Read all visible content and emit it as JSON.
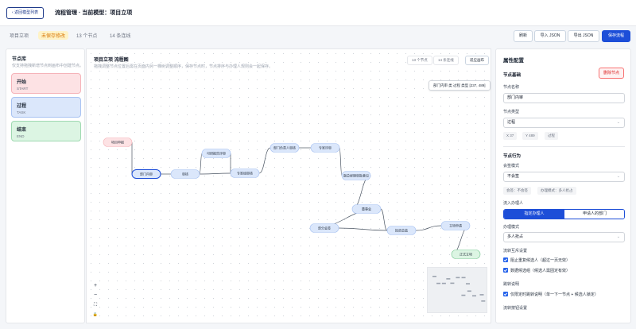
{
  "topbar": {
    "back_label": "返回模型列表",
    "title": "流程管理 · 当前模型：项目立项"
  },
  "status": {
    "model_name": "项目立项",
    "unsaved": "未保存修改",
    "node_count": "13 个节点",
    "edge_count": "14 条连线"
  },
  "toolbar": {
    "refresh": "刷新",
    "import_json": "导入 JSON",
    "export_json": "导出 JSON",
    "save_model": "保存流程"
  },
  "palette": {
    "title": "节点库",
    "subtitle": "仅支持拖拽新增节点到画布中创建节点。",
    "items": [
      {
        "name": "开始",
        "code": "START",
        "bg": "#fde2e4",
        "border": "#f5b3b9"
      },
      {
        "name": "过程",
        "code": "TASK",
        "bg": "#dbe7fb",
        "border": "#a9c3f2"
      },
      {
        "name": "结束",
        "code": "END",
        "bg": "#dcf5e3",
        "border": "#9fd9b1"
      }
    ]
  },
  "canvas": {
    "title": "项目立项 流程图",
    "subtitle": "拖拽调整节点位置后需在页面内另一棵树调整顺序，保存节点时，节点排序与办理人规则会一起保存。",
    "node_count": "13 个节点",
    "edge_count": "14 条连线",
    "reset_view": "适应画布",
    "tooltip": "部门内审 类 过程 类型 [237, 489]",
    "zoom_in": "+",
    "zoom_out": "−",
    "fit": "⛶",
    "lock": "🔒",
    "nodes": [
      {
        "id": "n1",
        "label": "项目申报",
        "type": "start"
      },
      {
        "id": "n2",
        "label": "部门内审",
        "type": "task",
        "selected": true
      },
      {
        "id": "n3",
        "label": "审核",
        "type": "task"
      },
      {
        "id": "n4",
        "label": "可研报告评审",
        "type": "task"
      },
      {
        "id": "n5",
        "label": "专家组审核",
        "type": "task"
      },
      {
        "id": "n6",
        "label": "部门负责人审核",
        "type": "task"
      },
      {
        "id": "n7",
        "label": "专家评审",
        "type": "task"
      },
      {
        "id": "n8",
        "label": "副总经理审批意见",
        "type": "task"
      },
      {
        "id": "n9",
        "label": "董事会",
        "type": "task"
      },
      {
        "id": "n10",
        "label": "部分会签",
        "type": "task"
      },
      {
        "id": "n11",
        "label": "投资总监",
        "type": "task"
      },
      {
        "id": "n12",
        "label": "立项申请",
        "type": "task"
      },
      {
        "id": "n13",
        "label": "正式立项",
        "type": "end"
      }
    ]
  },
  "props": {
    "title": "属性配置",
    "section_basic": "节点基础",
    "delete_btn": "删除节点",
    "name_label": "节点名称",
    "name_value": "部门内审",
    "type_label": "节点类型",
    "type_value": "过程",
    "coord_x": "X 37",
    "coord_y": "Y 489",
    "type_chip": "过程",
    "section_behavior": "节点行为",
    "countersign_label": "会签模式",
    "countersign_value": "不会签",
    "chip_countersign": "会签：不会签",
    "chip_approval": "办理模式：多人抢占",
    "handler_label": "流入办理人",
    "handler_opt1": "指定办理人",
    "handler_opt2": "申请人的部门",
    "mode_label": "办理模式",
    "mode_value": "多人抢占",
    "exclusion_label": "流转互斥设置",
    "check1": "阻止重复候选人（超过一页无效）",
    "check2": "数据候选组（候选人需固定有效）",
    "rule_label": "跳转说明",
    "check3": "仅限定时跳转说明（单一下一节点 + 候选人锁定）",
    "transfer_label": "流转按钮设置"
  }
}
